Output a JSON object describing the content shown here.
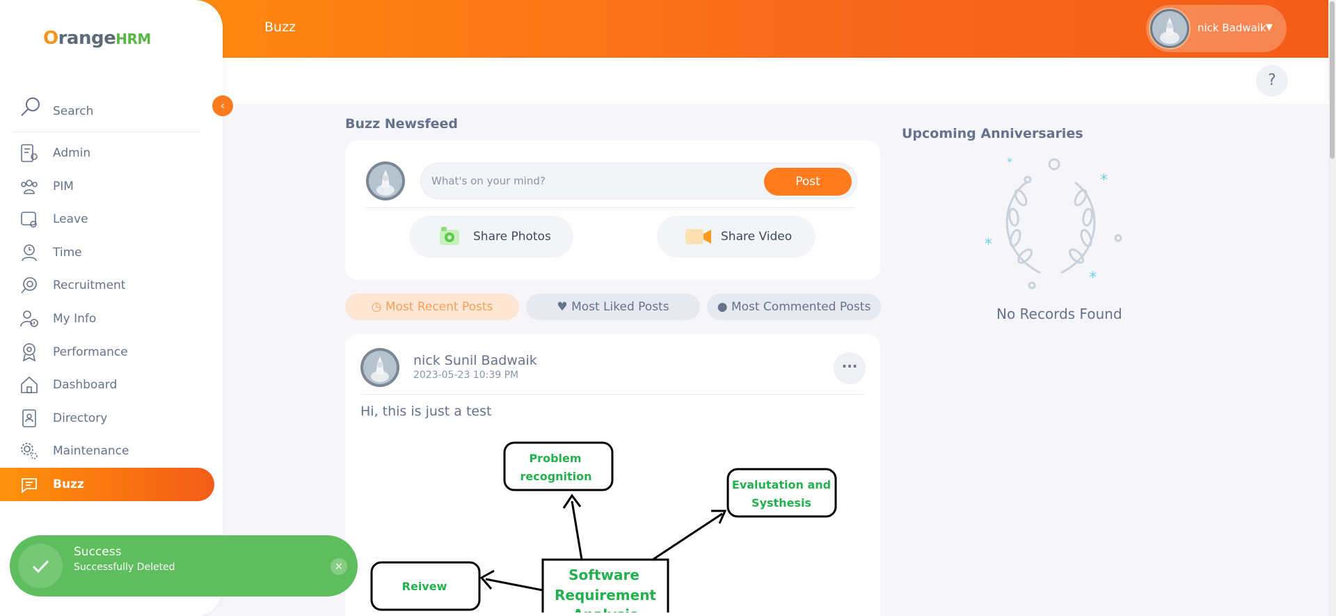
{
  "app": {
    "brand_o": "O",
    "brand_rest": "range",
    "brand_hrm": "HRM",
    "module_title": "Buzz",
    "user_name": "nick Badwaik",
    "help_label": "?"
  },
  "sidebar": {
    "search_label": "Search",
    "items": [
      {
        "label": "Admin",
        "icon": "admin-icon"
      },
      {
        "label": "PIM",
        "icon": "pim-icon"
      },
      {
        "label": "Leave",
        "icon": "leave-icon"
      },
      {
        "label": "Time",
        "icon": "time-icon"
      },
      {
        "label": "Recruitment",
        "icon": "recruitment-icon"
      },
      {
        "label": "My Info",
        "icon": "my-info-icon"
      },
      {
        "label": "Performance",
        "icon": "performance-icon"
      },
      {
        "label": "Dashboard",
        "icon": "dashboard-icon"
      },
      {
        "label": "Directory",
        "icon": "directory-icon"
      },
      {
        "label": "Maintenance",
        "icon": "maintenance-icon"
      },
      {
        "label": "Buzz",
        "icon": "buzz-icon"
      }
    ],
    "active_index": 10
  },
  "newsfeed": {
    "title": "Buzz Newsfeed",
    "placeholder": "What's on your mind?",
    "post_label": "Post",
    "share_photos": "Share Photos",
    "share_video": "Share Video",
    "tabs": {
      "recent": "Most Recent Posts",
      "liked": "Most Liked Posts",
      "commented": "Most Commented Posts"
    }
  },
  "post": {
    "author": "nick Sunil Badwaik",
    "timestamp": "2023-05-23 10:39 PM",
    "text": "Hi, this is just a test",
    "image_boxes": {
      "problem1": "Problem",
      "problem2": "recognition",
      "eval1": "Evalutation and",
      "eval2": "Systhesis",
      "review": "Reivew",
      "srs1": "Software",
      "srs2": "Requirement",
      "srs3": "Analysis"
    }
  },
  "anniversaries": {
    "title": "Upcoming Anniversaries",
    "empty": "No Records Found"
  },
  "toast": {
    "title": "Success",
    "message": "Successfully Deleted",
    "close": "×"
  },
  "colors": {
    "accent": "#ff7b1d",
    "success": "#5ebe5e",
    "diagram_text": "#22b14c"
  }
}
